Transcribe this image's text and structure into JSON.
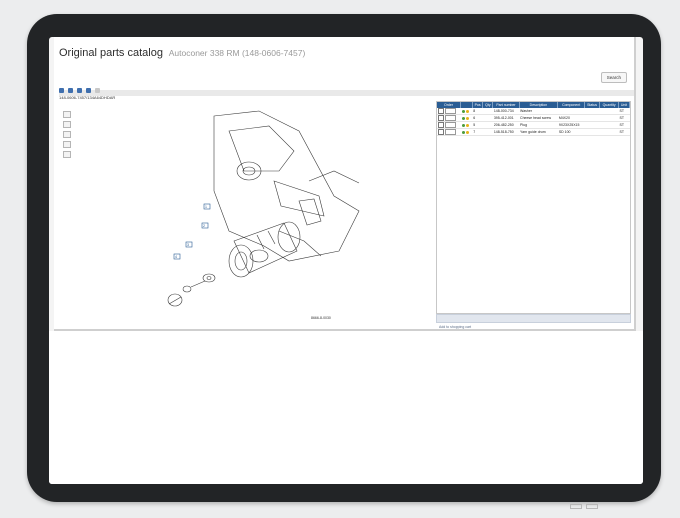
{
  "app": {
    "title": "Original parts catalog",
    "subtitle": "Autoconer 338 RM (148-0606-7457)",
    "search_label": "Search"
  },
  "toolbar": {
    "icons": [
      "grid-icon",
      "tree-icon",
      "zoom-icon",
      "print-icon",
      "info-icon"
    ]
  },
  "path": "148-0606-7457/134A64DHDAR",
  "drawing": {
    "caption": "8666-8-0030",
    "callouts": [
      "1",
      "2",
      "3",
      "4"
    ]
  },
  "table": {
    "headers": [
      "Order",
      "",
      "Pos",
      "Qty",
      "Part number",
      "Description",
      "Component",
      "Status",
      "Quantity",
      "Unit"
    ],
    "rows": [
      {
        "pos": "8",
        "part": "148-000-734",
        "desc": "Washer",
        "comp": "",
        "unit": "ST"
      },
      {
        "pos": "6",
        "part": "395-412-001",
        "desc": "Cheese head screw",
        "comp": "M4X20",
        "unit": "ST"
      },
      {
        "pos": "5",
        "part": "206-482-250",
        "desc": "Plug",
        "comp": "9X23X25X15",
        "unit": "ST"
      },
      {
        "pos": "7",
        "part": "148-518-750",
        "desc": "Yarn guide drum",
        "comp": "SD 100",
        "unit": "ST"
      }
    ]
  },
  "status_link": "Add to shopping cart"
}
